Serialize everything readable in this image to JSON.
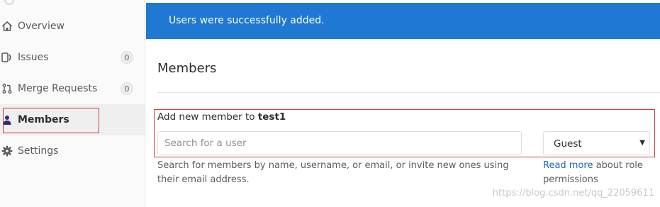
{
  "sidebar": {
    "items": [
      {
        "label": "Overview",
        "icon": "home-icon"
      },
      {
        "label": "Issues",
        "icon": "issues-icon",
        "count": "0"
      },
      {
        "label": "Merge Requests",
        "icon": "merge-request-icon",
        "count": "0"
      },
      {
        "label": "Members",
        "icon": "members-icon",
        "active": true
      },
      {
        "label": "Settings",
        "icon": "settings-icon"
      }
    ]
  },
  "flash": {
    "message": "Users were successfully added.",
    "color": "#1f78d1"
  },
  "main": {
    "title": "Members",
    "add_member": {
      "label_prefix": "Add new member to",
      "project": "test1",
      "search_placeholder": "Search for a user",
      "role_value": "Guest",
      "help_text": "Search for members by name, username, or email, or invite new ones using their email address.",
      "read_more": "Read more",
      "role_help_suffix": "about role permissions"
    }
  },
  "watermark": "https://blog.csdn.net/qq_22059611",
  "accent": "#1b69b6",
  "annotation_color": "#d9383a"
}
